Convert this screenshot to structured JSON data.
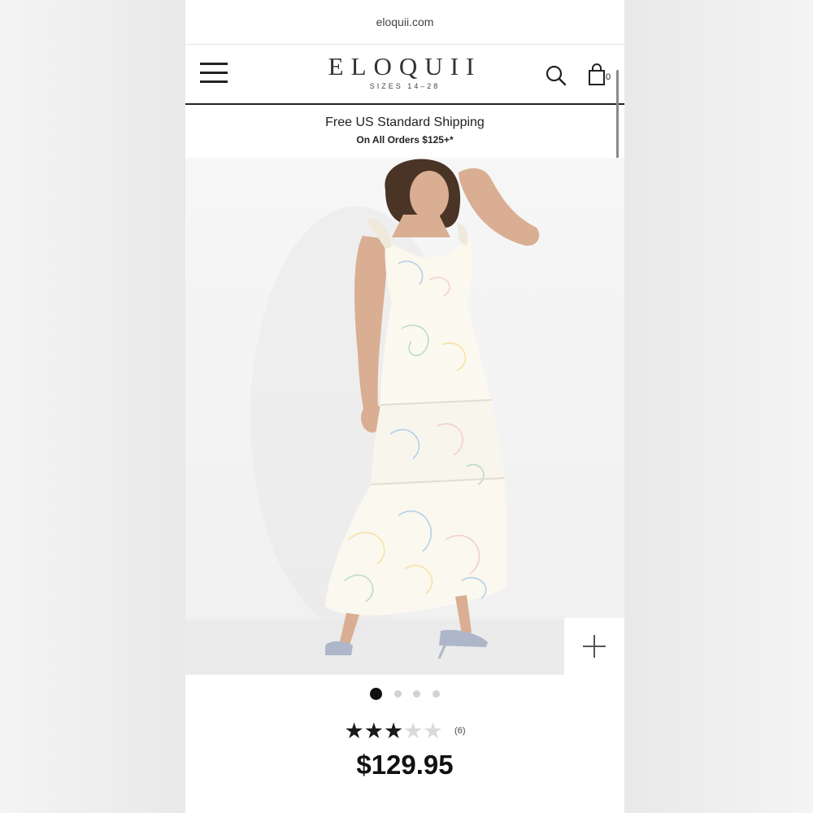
{
  "browser": {
    "url": "eloquii.com"
  },
  "header": {
    "brand": "ELOQUII",
    "brand_tagline": "SIZES 14–28",
    "menu_icon": "hamburger-menu-icon",
    "search_icon": "search-icon",
    "cart_icon": "shopping-bag-icon",
    "cart_count": "0"
  },
  "promo": {
    "title": "Free US Standard Shipping",
    "subtitle": "On All Orders $125+*"
  },
  "gallery": {
    "image_description": "Model wearing a white tiered maxi dress with pastel sketch print",
    "zoom_icon": "plus-icon",
    "total_images": 4,
    "active_index": 0
  },
  "product": {
    "rating": 3,
    "rating_max": 5,
    "review_count": "(6)",
    "price": "$129.95"
  }
}
